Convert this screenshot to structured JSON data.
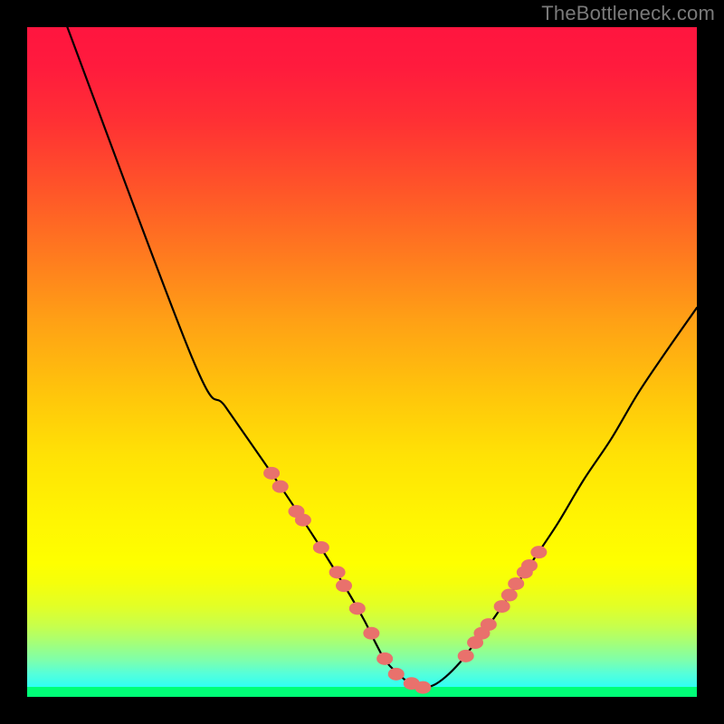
{
  "watermark": "TheBottleneck.com",
  "chart_data": {
    "type": "line",
    "title": "",
    "xlabel": "",
    "ylabel": "",
    "xlim": [
      0,
      100
    ],
    "ylim": [
      0,
      100
    ],
    "series": [
      {
        "name": "curve",
        "x": [
          6,
          24.6,
          29.7,
          36.7,
          43.0,
          47.6,
          50.3,
          52.0,
          53.5,
          55.4,
          57.2,
          58.8,
          60.6,
          62.5,
          64.6,
          65.9,
          67.8,
          70.9,
          75.0,
          79.1,
          83.1,
          87.2,
          91.2,
          95.3,
          100.0
        ],
        "y": [
          100.0,
          50.7,
          43.2,
          33.1,
          23.6,
          16.2,
          11.5,
          8.1,
          5.4,
          3.4,
          2.0,
          1.4,
          1.7,
          3.0,
          5.1,
          6.8,
          9.1,
          13.5,
          19.6,
          25.7,
          32.4,
          38.5,
          45.3,
          51.4,
          58.1
        ]
      },
      {
        "name": "markers-left",
        "x": [
          36.5,
          37.8,
          40.2,
          41.2,
          43.9,
          46.3,
          47.3,
          49.3,
          51.4,
          53.4,
          55.1,
          57.4,
          59.1
        ],
        "y": [
          33.4,
          31.4,
          27.7,
          26.4,
          22.3,
          18.6,
          16.6,
          13.2,
          9.5,
          5.7,
          3.4,
          2.0,
          1.4
        ]
      },
      {
        "name": "markers-right",
        "x": [
          65.5,
          66.9,
          67.9,
          68.9,
          70.9,
          72.0,
          73.0,
          74.3,
          75.0,
          76.4
        ],
        "y": [
          6.1,
          8.1,
          9.5,
          10.8,
          13.5,
          15.2,
          16.9,
          18.6,
          19.6,
          21.6
        ]
      }
    ],
    "gradient": [
      {
        "offset": 0.0,
        "color": "#ff153f"
      },
      {
        "offset": 0.06,
        "color": "#ff1b3d"
      },
      {
        "offset": 0.14,
        "color": "#ff3034"
      },
      {
        "offset": 0.24,
        "color": "#ff5429"
      },
      {
        "offset": 0.34,
        "color": "#ff7a1f"
      },
      {
        "offset": 0.44,
        "color": "#ffa115"
      },
      {
        "offset": 0.55,
        "color": "#ffc60b"
      },
      {
        "offset": 0.64,
        "color": "#ffe205"
      },
      {
        "offset": 0.74,
        "color": "#fff602"
      },
      {
        "offset": 0.8,
        "color": "#feff00"
      },
      {
        "offset": 0.83,
        "color": "#f5ff0b"
      },
      {
        "offset": 0.865,
        "color": "#e2ff27"
      },
      {
        "offset": 0.895,
        "color": "#c6ff4d"
      },
      {
        "offset": 0.92,
        "color": "#a4ff79"
      },
      {
        "offset": 0.945,
        "color": "#7effab"
      },
      {
        "offset": 0.965,
        "color": "#56ffd9"
      },
      {
        "offset": 0.985,
        "color": "#30fff4"
      },
      {
        "offset": 0.985,
        "color": "#00ff78"
      },
      {
        "offset": 1.0,
        "color": "#00ff78"
      }
    ],
    "marker_style": {
      "color": "#e9716c",
      "rx": 9,
      "ry": 7
    }
  }
}
